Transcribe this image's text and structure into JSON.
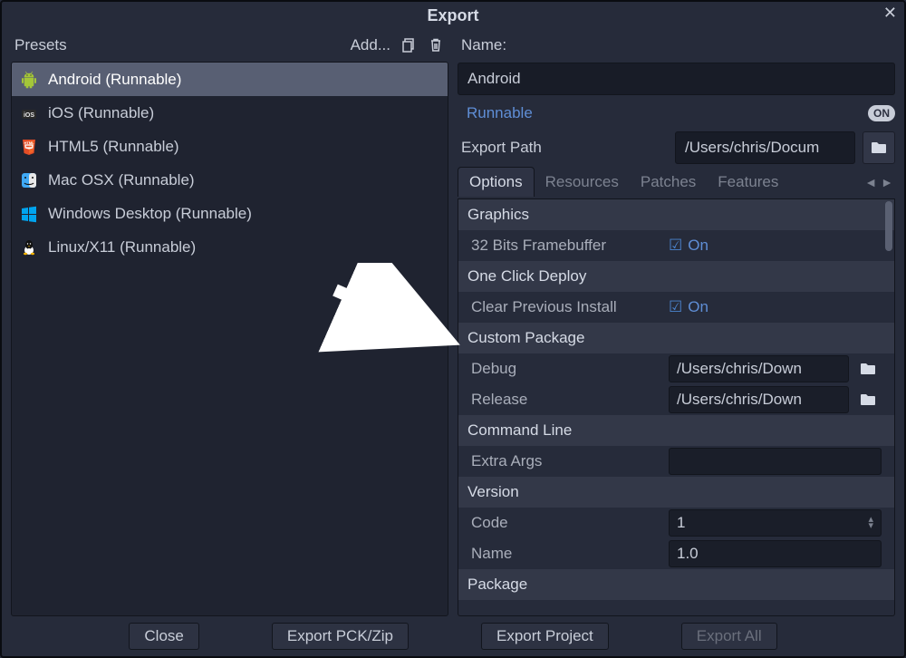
{
  "title": "Export",
  "presets_label": "Presets",
  "add_label": "Add...",
  "presets": [
    {
      "id": "android",
      "label": "Android (Runnable)",
      "selected": true
    },
    {
      "id": "ios",
      "label": "iOS (Runnable)",
      "selected": false
    },
    {
      "id": "html5",
      "label": "HTML5 (Runnable)",
      "selected": false
    },
    {
      "id": "macosx",
      "label": "Mac OSX (Runnable)",
      "selected": false
    },
    {
      "id": "windows",
      "label": "Windows Desktop (Runnable)",
      "selected": false
    },
    {
      "id": "linux",
      "label": "Linux/X11 (Runnable)",
      "selected": false
    }
  ],
  "name_label": "Name:",
  "name_value": "Android",
  "runnable_label": "Runnable",
  "runnable_badge": "ON",
  "export_path_label": "Export Path",
  "export_path_value": "/Users/chris/Docum",
  "tabs": {
    "options": "Options",
    "resources": "Resources",
    "patches": "Patches",
    "features": "Features",
    "active": "options"
  },
  "options": {
    "graphics_section": "Graphics",
    "framebuffer_label": "32 Bits Framebuffer",
    "framebuffer_on": "On",
    "oneclick_section": "One Click Deploy",
    "clear_prev_label": "Clear Previous Install",
    "clear_prev_on": "On",
    "custom_pkg_section": "Custom Package",
    "debug_label": "Debug",
    "debug_value": "/Users/chris/Down",
    "release_label": "Release",
    "release_value": "/Users/chris/Down",
    "cmdline_section": "Command Line",
    "extra_args_label": "Extra Args",
    "extra_args_value": "",
    "version_section": "Version",
    "code_label": "Code",
    "code_value": "1",
    "name_label": "Name",
    "name_value": "1.0",
    "package_section": "Package"
  },
  "footer": {
    "close": "Close",
    "export_pck": "Export PCK/Zip",
    "export_project": "Export Project",
    "export_all": "Export All"
  }
}
